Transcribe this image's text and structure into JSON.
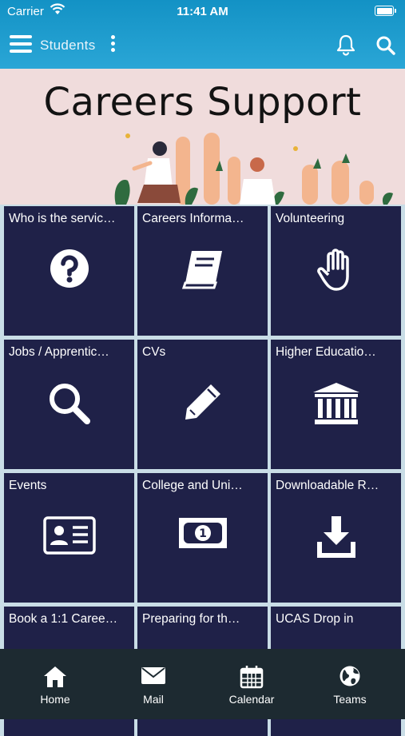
{
  "status_bar": {
    "carrier": "Carrier",
    "time": "11:41 AM"
  },
  "toolbar": {
    "title": "Students"
  },
  "banner": {
    "title": "Careers Support"
  },
  "tiles": [
    {
      "label": "Who is the servic…",
      "icon": "question-icon"
    },
    {
      "label": "Careers Informa…",
      "icon": "book-icon"
    },
    {
      "label": "Volunteering",
      "icon": "hand-icon"
    },
    {
      "label": "Jobs / Apprentic…",
      "icon": "search-icon"
    },
    {
      "label": "CVs",
      "icon": "pencil-icon"
    },
    {
      "label": "Higher Educatio…",
      "icon": "institution-icon"
    },
    {
      "label": "Events",
      "icon": "id-card-icon"
    },
    {
      "label": "College and Uni…",
      "icon": "money-icon"
    },
    {
      "label": "Downloadable R…",
      "icon": "download-icon"
    },
    {
      "label": "Book a 1:1 Caree…",
      "icon": ""
    },
    {
      "label": "Preparing for th…",
      "icon": ""
    },
    {
      "label": "UCAS Drop in",
      "icon": ""
    }
  ],
  "tabbar": [
    {
      "label": "Home",
      "icon": "home-icon"
    },
    {
      "label": "Mail",
      "icon": "mail-icon"
    },
    {
      "label": "Calendar",
      "icon": "calendar-icon"
    },
    {
      "label": "Teams",
      "icon": "globe-icon"
    }
  ],
  "colors": {
    "header": "#1e9dcf",
    "tile": "#1f2148",
    "tabbar": "#1d2a31",
    "banner": "#f0dcdc"
  }
}
